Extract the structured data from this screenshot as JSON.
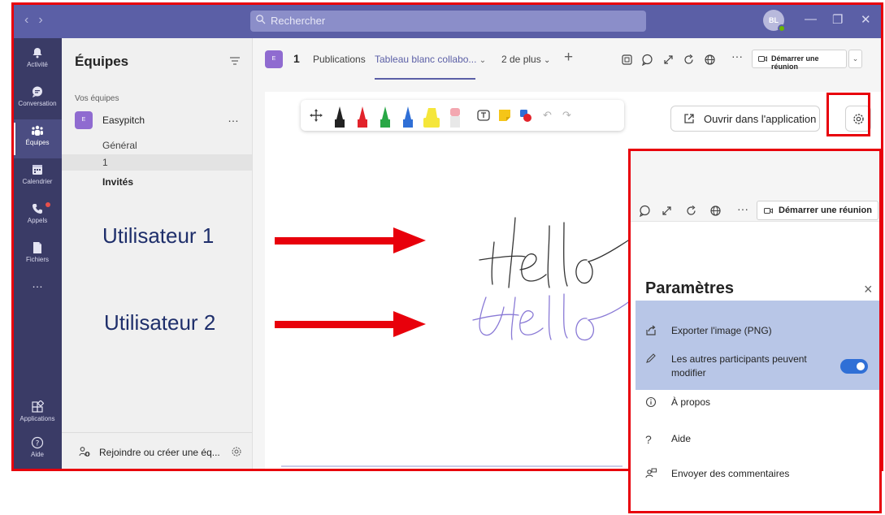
{
  "titlebar": {
    "search_placeholder": "Rechercher",
    "avatar_initials": "BL",
    "back_glyph": "‹",
    "forward_glyph": "›",
    "minimize_glyph": "—",
    "restore_glyph": "❐",
    "close_glyph": "✕"
  },
  "rail": {
    "items": [
      {
        "label": "Activité",
        "icon": "bell-icon"
      },
      {
        "label": "Conversation",
        "icon": "chat-icon"
      },
      {
        "label": "Équipes",
        "icon": "teams-icon"
      },
      {
        "label": "Calendrier",
        "icon": "calendar-icon"
      },
      {
        "label": "Appels",
        "icon": "phone-icon"
      },
      {
        "label": "Fichiers",
        "icon": "file-icon"
      },
      {
        "label": "Applications",
        "icon": "apps-icon"
      },
      {
        "label": "Aide",
        "icon": "help-icon"
      }
    ],
    "more": "…"
  },
  "teams_panel": {
    "title": "Équipes",
    "section": "Vos équipes",
    "team": {
      "badge": "E",
      "name": "Easypitch",
      "more": "…"
    },
    "channels": [
      "Général",
      "1",
      "Invités"
    ],
    "join_label": "Rejoindre ou créer une éq..."
  },
  "channel_header": {
    "badge": "E",
    "name": "1",
    "tabs": [
      "Publications",
      "Tableau blanc collabo...",
      "2 de plus"
    ],
    "tab_chevron": "⌄",
    "plus": "+",
    "more": "···",
    "meet_button": "Démarrer une réunion",
    "meet_dropdown": "⌄"
  },
  "whiteboard": {
    "open_app_button": "Ouvrir dans l'application",
    "handwriting": [
      "Hello",
      "Hello"
    ],
    "colors": {
      "pen_black": "#222222",
      "pen_red": "#e2232b",
      "pen_green": "#28a745",
      "pen_blue": "#2f6fd6",
      "highlighter": "#f5e63a",
      "eraser": "#f3a7b0",
      "ink1": "#333333",
      "ink2": "#8a7ad6"
    }
  },
  "zoom_panel": {
    "more": "···",
    "meet_button": "Démarrer une réunion",
    "settings_title": "Paramètres",
    "close": "×",
    "items": [
      {
        "label": "Exporter l'image (PNG)",
        "icon": "export-icon"
      },
      {
        "label": "Les autres participants peuvent modifier",
        "icon": "pencil-icon",
        "toggle": "on"
      },
      {
        "label": "À propos",
        "icon": "info-icon"
      },
      {
        "label": "Aide",
        "icon": "question-icon"
      },
      {
        "label": "Envoyer des commentaires",
        "icon": "feedback-icon"
      }
    ]
  },
  "annotations": {
    "user1": "Utilisateur 1",
    "user2": "Utilisateur 2",
    "accent_red": "#e8000b",
    "label_color": "#1f2f6b"
  }
}
